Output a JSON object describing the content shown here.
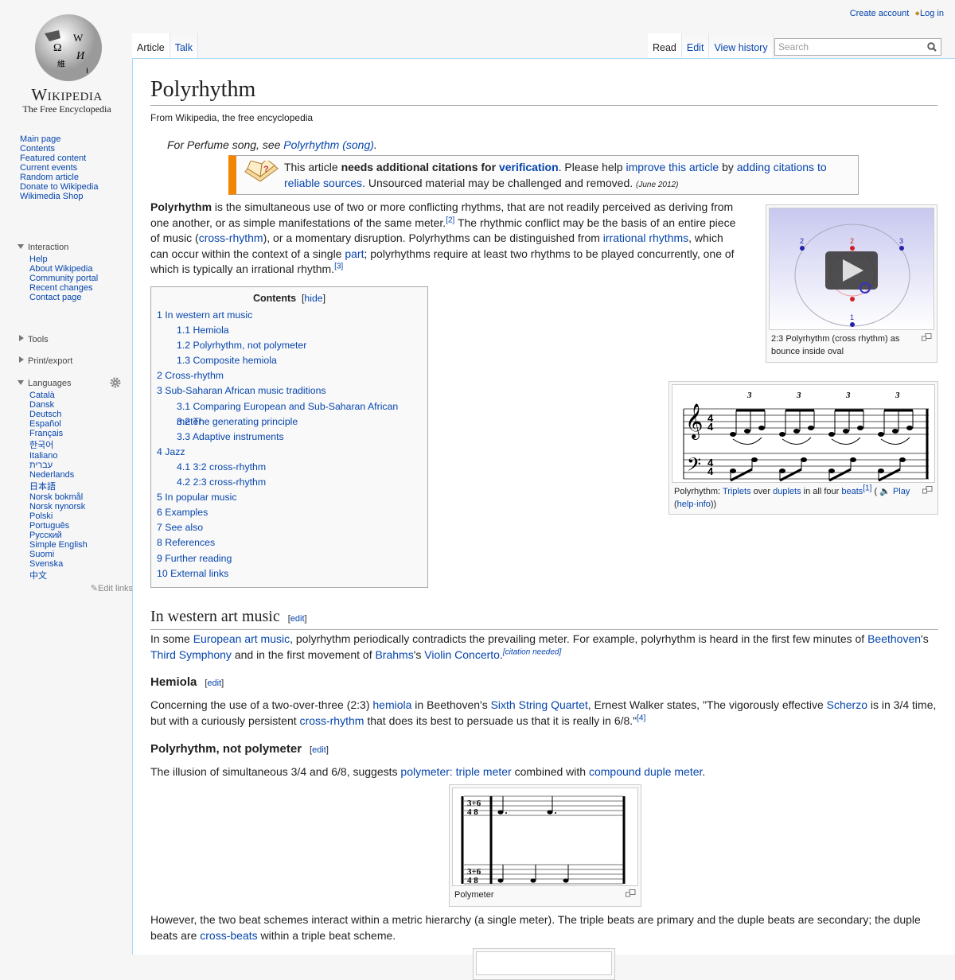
{
  "logo": {
    "wordmark": "Wikipedia",
    "tagline": "The Free Encyclopedia"
  },
  "personal": {
    "create": "Create account",
    "login": "Log in"
  },
  "tabs": {
    "left": [
      "Article",
      "Talk"
    ],
    "right": [
      "Read",
      "Edit",
      "View history"
    ]
  },
  "search": {
    "placeholder": "Search"
  },
  "nav": [
    "Main page",
    "Contents",
    "Featured content",
    "Current events",
    "Random article",
    "Donate to Wikipedia",
    "Wikimedia Shop"
  ],
  "interaction": {
    "title": "Interaction",
    "items": [
      "Help",
      "About Wikipedia",
      "Community portal",
      "Recent changes",
      "Contact page"
    ]
  },
  "tools": "Tools",
  "printexport": "Print/export",
  "languages": {
    "title": "Languages",
    "items": [
      "Català",
      "Dansk",
      "Deutsch",
      "Español",
      "Français",
      "한국어",
      "Italiano",
      "עברית",
      "Nederlands",
      "日本語",
      "Norsk bokmål",
      "Norsk nynorsk",
      "Polski",
      "Português",
      "Русский",
      "Simple English",
      "Suomi",
      "Svenska",
      "中文"
    ],
    "edit_links": "Edit links"
  },
  "title": "Polyrhythm",
  "subtitle": "From Wikipedia, the free encyclopedia",
  "hatnote": [
    {
      "t": "For Perfume song, see "
    },
    {
      "t": "Polyrhythm (song)",
      "l": 1
    },
    {
      "t": "."
    }
  ],
  "ambox": [
    {
      "t": "This article "
    },
    {
      "t": "needs additional citations for ",
      "b": 1
    },
    {
      "t": "verification",
      "l": 1,
      "b": 1
    },
    {
      "t": ". Please help "
    },
    {
      "t": "improve this article",
      "l": 1
    },
    {
      "t": " by "
    },
    {
      "t": "adding citations to reliable sources",
      "l": 1
    },
    {
      "t": ". Unsourced material may be challenged and removed. "
    },
    {
      "t": "(June 2012)",
      "s": 1
    }
  ],
  "intro": [
    {
      "t": "Polyrhythm",
      "b": 1
    },
    {
      "t": " is the simultaneous use of two or more conflicting rhythms, that are not readily perceived as deriving from one another, or as simple manifestations of the same meter."
    },
    {
      "t": "[2]",
      "l": 1,
      "sup": 1
    },
    {
      "t": " The rhythmic conflict may be the basis of an entire piece of music ("
    },
    {
      "t": "cross-rhythm",
      "l": 1
    },
    {
      "t": "), or a momentary disruption. Polyrhythms can be distinguished from "
    },
    {
      "t": "irrational rhythms",
      "l": 1
    },
    {
      "t": ", which can occur within the context of a single "
    },
    {
      "t": "part",
      "l": 1
    },
    {
      "t": "; polyrhythms require at least two rhythms to be played concurrently, one of which is typically an irrational rhythm."
    },
    {
      "t": "[3]",
      "l": 1,
      "sup": 1
    }
  ],
  "fig1": {
    "caption": "2:3 Polyrhythm (cross rhythm) as bounce inside oval",
    "labels": [
      "2",
      "2",
      "3",
      "1"
    ]
  },
  "fig2": {
    "triplet": "3",
    "caption": [
      {
        "t": "Polyrhythm: "
      },
      {
        "t": "Triplets",
        "l": 1
      },
      {
        "t": " over "
      },
      {
        "t": "duplets",
        "l": 1
      },
      {
        "t": " in all four "
      },
      {
        "t": "beats",
        "l": 1
      },
      {
        "t": "[1]",
        "l": 1,
        "sup": 1
      },
      {
        "t": " ("
      },
      {
        "t": " 🔈 "
      },
      {
        "t": "Play",
        "l": 1
      },
      {
        "t": " ("
      },
      {
        "t": "help",
        "l": 1
      },
      {
        "t": "·"
      },
      {
        "t": "info",
        "l": 1
      },
      {
        "t": "))"
      }
    ]
  },
  "toc": {
    "title": "Contents",
    "hide": "hide",
    "items": [
      {
        "n": "1",
        "t": "In western art music",
        "lv": 1
      },
      {
        "n": "1.1",
        "t": "Hemiola",
        "lv": 2
      },
      {
        "n": "1.2",
        "t": "Polyrhythm, not polymeter",
        "lv": 2
      },
      {
        "n": "1.3",
        "t": "Composite hemiola",
        "lv": 2
      },
      {
        "n": "2",
        "t": "Cross-rhythm",
        "lv": 1
      },
      {
        "n": "3",
        "t": "Sub-Saharan African music traditions",
        "lv": 1
      },
      {
        "n": "3.1",
        "t": "Comparing European and Sub-Saharan African meter",
        "lv": 2
      },
      {
        "n": "3.2",
        "t": "The generating principle",
        "lv": 2
      },
      {
        "n": "3.3",
        "t": "Adaptive instruments",
        "lv": 2
      },
      {
        "n": "4",
        "t": "Jazz",
        "lv": 1
      },
      {
        "n": "4.1",
        "t": "3:2 cross-rhythm",
        "lv": 2
      },
      {
        "n": "4.2",
        "t": "2:3 cross-rhythm",
        "lv": 2
      },
      {
        "n": "5",
        "t": "In popular music",
        "lv": 1
      },
      {
        "n": "6",
        "t": "Examples",
        "lv": 1
      },
      {
        "n": "7",
        "t": "See also",
        "lv": 1
      },
      {
        "n": "8",
        "t": "References",
        "lv": 1
      },
      {
        "n": "9",
        "t": "Further reading",
        "lv": 1
      },
      {
        "n": "10",
        "t": "External links",
        "lv": 1
      }
    ]
  },
  "edit_label": "edit",
  "s1": {
    "title": "In western art music",
    "p": [
      {
        "t": "In some "
      },
      {
        "t": "European art music",
        "l": 1
      },
      {
        "t": ", polyrhythm periodically contradicts the prevailing meter. For example, polyrhythm is heard in the first few minutes of "
      },
      {
        "t": "Beethoven",
        "l": 1
      },
      {
        "t": "'s "
      },
      {
        "t": "Third Symphony",
        "l": 1
      },
      {
        "t": " and in the first movement of "
      },
      {
        "t": "Brahms",
        "l": 1
      },
      {
        "t": "'s "
      },
      {
        "t": "Violin Concerto",
        "l": 1
      },
      {
        "t": "."
      },
      {
        "t": "[citation needed]",
        "l": 1,
        "sup": 1,
        "i": 1
      }
    ]
  },
  "s11": {
    "title": "Hemiola",
    "p": [
      {
        "t": "Concerning the use of a two-over-three (2:3) "
      },
      {
        "t": "hemiola",
        "l": 1
      },
      {
        "t": " in Beethoven's "
      },
      {
        "t": "Sixth String Quartet",
        "l": 1
      },
      {
        "t": ", Ernest Walker states, \"The vigorously effective "
      },
      {
        "t": "Scherzo",
        "l": 1
      },
      {
        "t": " is in 3/4 time, but with a curiously persistent "
      },
      {
        "t": "cross-rhythm",
        "l": 1
      },
      {
        "t": " that does its best to persuade us that it is really in 6/8.\""
      },
      {
        "t": "[4]",
        "l": 1,
        "sup": 1
      }
    ]
  },
  "s12": {
    "title": "Polyrhythm, not polymeter",
    "p": [
      {
        "t": "The illusion of simultaneous 3/4 and 6/8, suggests "
      },
      {
        "t": "polymeter: triple meter",
        "l": 1
      },
      {
        "t": " combined with "
      },
      {
        "t": "compound duple meter",
        "l": 1
      },
      {
        "t": "."
      }
    ]
  },
  "fig3": {
    "caption": "Polymeter",
    "time_sig": "3+6 / 4 8"
  },
  "p_after": [
    {
      "t": "However, the two beat schemes interact within a metric hierarchy (a single meter). The triple beats are primary and the duple beats are secondary; the duple beats are "
    },
    {
      "t": "cross-beats",
      "l": 1
    },
    {
      "t": " within a triple beat scheme."
    }
  ],
  "colors": {
    "link": "#0645ad",
    "ambox_stripe": "#f28500",
    "sidebar_bg": "#f6f6f6"
  }
}
